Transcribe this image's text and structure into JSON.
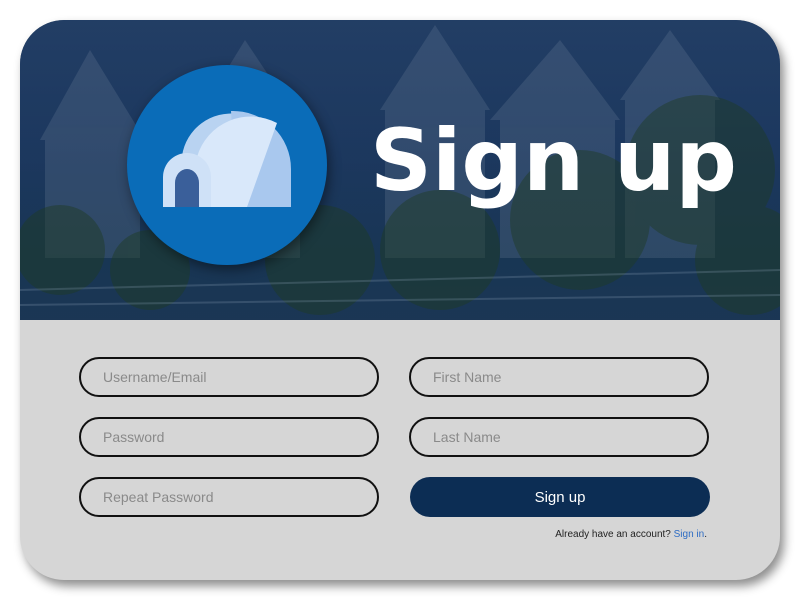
{
  "hero": {
    "title": "Sign up",
    "logo_icon": "igloo-icon"
  },
  "form": {
    "username_placeholder": "Username/Email",
    "password_placeholder": "Password",
    "repeat_password_placeholder": "Repeat Password",
    "first_name_placeholder": "First Name",
    "last_name_placeholder": "Last Name",
    "submit_label": "Sign up",
    "signin_prompt": "Already have an account?",
    "signin_link": "Sign in",
    "signin_suffix": "."
  },
  "colors": {
    "hero_overlay": "#12305c",
    "logo_circle": "#0a6cb8",
    "button": "#0c2d54",
    "form_bg": "#d6d6d6",
    "link": "#2d6cc4"
  }
}
